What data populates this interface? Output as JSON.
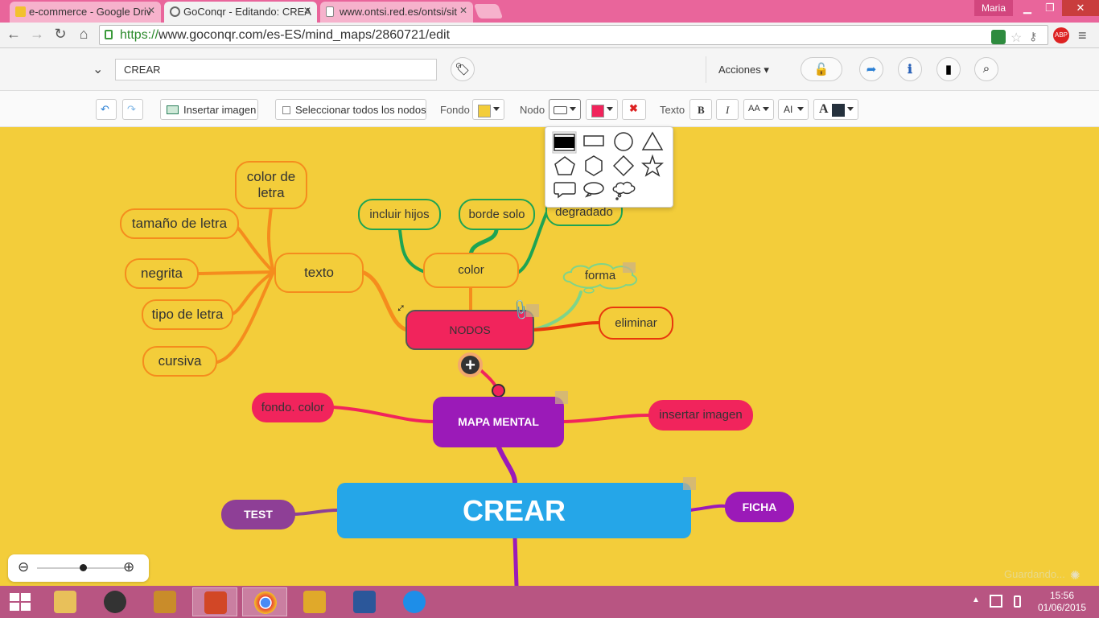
{
  "browser": {
    "tabs": [
      {
        "label": "e-commerce - Google Driv",
        "icon": "google-drive-icon",
        "active": false
      },
      {
        "label": "GoConqr - Editando: CREA",
        "icon": "goconqr-icon",
        "active": true
      },
      {
        "label": "www.ontsi.red.es/ontsi/sit",
        "icon": "document-icon",
        "active": false
      }
    ],
    "user": "Maria",
    "url_scheme": "https://",
    "url_rest": "www.goconqr.com/es-ES/mind_maps/2860721/edit"
  },
  "header": {
    "title_value": "CREAR",
    "actions_label": "Acciones"
  },
  "toolbar": {
    "insert_image": "Insertar imagen",
    "select_all": "Seleccionar todos los nodos",
    "fondo_label": "Fondo",
    "fondo_color": "#f3cd3a",
    "nodo_label": "Nodo",
    "nodo_color": "#f1245c",
    "texto_label": "Texto",
    "bold": "B",
    "italic": "I",
    "font_size": "AA",
    "font_family": "AI",
    "text_color_glyph": "A",
    "text_color": "#25313d"
  },
  "shape_picker": {
    "options": [
      "rounded-rect-filled",
      "rectangle",
      "circle",
      "triangle",
      "pentagon",
      "hexagon",
      "diamond",
      "star",
      "callout-rect",
      "ellipse",
      "cloud"
    ]
  },
  "mindmap": {
    "central": "CREAR",
    "nodes": {
      "color_de_letra": "color de letra",
      "tamano": "tamaño de letra",
      "negrita": "negrita",
      "tipo": "tipo de letra",
      "cursiva": "cursiva",
      "texto": "texto",
      "incluir_hijos": "incluir hijos",
      "borde_solo": "borde solo",
      "degradado": "degradado",
      "color": "color",
      "forma": "forma",
      "nodos": "NODOS",
      "eliminar": "eliminar",
      "fondo_color": "fondo. color",
      "mapa_mental": "MAPA MENTAL",
      "insertar_imagen": "insertar imagen",
      "test": "TEST",
      "ficha": "FICHA"
    }
  },
  "status": {
    "saving": "Guardando..."
  },
  "taskbar": {
    "time": "15:56",
    "date": "01/06/2015"
  },
  "colors": {
    "canvas_bg": "#f3cd3a",
    "orange_branch": "#f58c1d",
    "green_branch": "#1ea453",
    "pink_node": "#f1245c",
    "purple_node": "#9b1ab8",
    "central_node": "#25a6e8",
    "tab_bar": "#e9659b",
    "taskbar": "#b85582"
  }
}
